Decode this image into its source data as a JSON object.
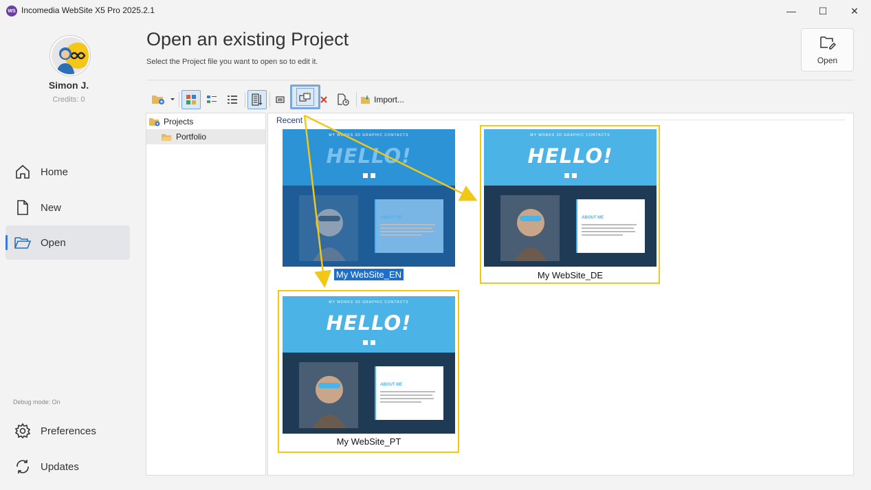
{
  "window": {
    "app_icon_text": "WS",
    "title": "Incomedia WebSite X5 Pro 2025.2.1",
    "minimize": "—",
    "maximize": "☐",
    "close": "✕"
  },
  "user": {
    "name": "Simon J.",
    "credits": "Credits: 0"
  },
  "nav": {
    "home": "Home",
    "new": "New",
    "open": "Open",
    "preferences": "Preferences",
    "updates": "Updates",
    "debug": "Debug mode: On"
  },
  "header": {
    "title": "Open an existing Project",
    "subtitle": "Select the Project file you want to open so to edit it.",
    "open_button": "Open"
  },
  "toolbar": {
    "import_label": "Import..."
  },
  "tree": {
    "root": "Projects",
    "child": "Portfolio"
  },
  "recent": {
    "label": "Recent",
    "thumb_menu": "MY WORKS    3D GRAPHIC    CONTACTS",
    "thumb_hello": "HELLO!",
    "thumb_about": "ABOUT ME",
    "items": [
      {
        "name": "My WebSite_EN",
        "selected": true
      },
      {
        "name": "My WebSite_DE",
        "selected": false
      },
      {
        "name": "My WebSite_PT",
        "selected": false
      }
    ]
  },
  "colors": {
    "highlight": "#f2c817",
    "selection": "#1f6fc6",
    "accent": "#3a7bd5",
    "thumb_sky": "#4bb3e6",
    "thumb_dark": "#1e3a55"
  },
  "icons": [
    "home-icon",
    "file-icon",
    "folder-open-icon",
    "gear-icon",
    "refresh-icon",
    "open-file-icon"
  ]
}
